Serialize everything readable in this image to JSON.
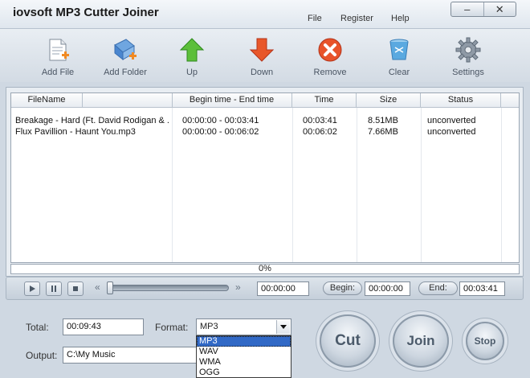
{
  "app": {
    "title": "iovsoft MP3 Cutter Joiner"
  },
  "menu": {
    "file": "File",
    "register": "Register",
    "help": "Help"
  },
  "window": {
    "minimize": "–",
    "close": "✕"
  },
  "toolbar": {
    "add_file": "Add File",
    "add_folder": "Add Folder",
    "up": "Up",
    "down": "Down",
    "remove": "Remove",
    "clear": "Clear",
    "settings": "Settings"
  },
  "table": {
    "columns": [
      "FileName",
      "Begin time - End time",
      "Time",
      "Size",
      "Status"
    ],
    "rows": [
      {
        "filename": "Breakage - Hard (Ft. David Rodigan & ...",
        "range": "00:00:00 - 00:03:41",
        "time": "00:03:41",
        "size": "8.51MB",
        "status": "unconverted"
      },
      {
        "filename": "Flux Pavillion - Haunt You.mp3",
        "range": "00:00:00 - 00:06:02",
        "time": "00:06:02",
        "size": "7.66MB",
        "status": "unconverted"
      }
    ]
  },
  "progress": {
    "text": "0%",
    "value": 0
  },
  "player": {
    "rewind": "«",
    "forward": "»",
    "position": "00:00:00",
    "seek_fraction": 0,
    "begin_label": "Begin:",
    "begin_value": "00:00:00",
    "end_label": "End:",
    "end_value": "00:03:41"
  },
  "bottom": {
    "total_label": "Total:",
    "total_value": "00:09:43",
    "format_label": "Format:",
    "format_value": "MP3",
    "format_options": [
      "MP3",
      "WAV",
      "WMA",
      "OGG"
    ],
    "output_label": "Output:",
    "output_value": "C:\\My Music",
    "cut": "Cut",
    "join": "Join",
    "stop": "Stop"
  },
  "colors": {
    "selection": "#3169c6",
    "background": "#cfd8e2"
  },
  "icons": [
    "add-file-icon",
    "add-folder-icon",
    "up-arrow-icon",
    "down-arrow-icon",
    "remove-icon",
    "clear-icon",
    "settings-icon",
    "play-icon",
    "pause-icon",
    "stop-icon",
    "dropdown-arrow-icon"
  ]
}
